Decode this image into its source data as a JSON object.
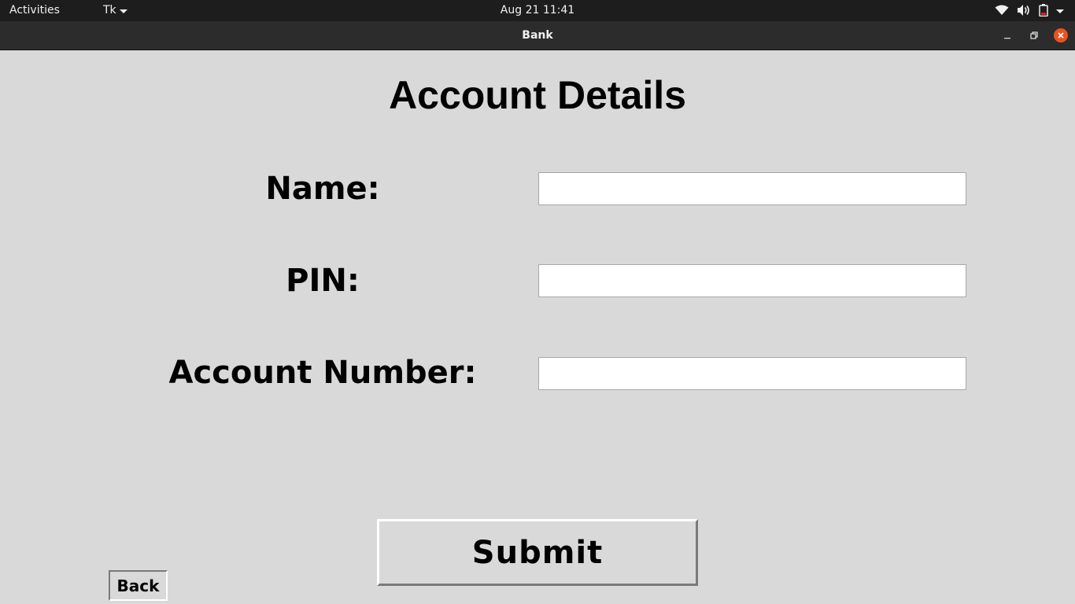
{
  "topbar": {
    "activities": "Activities",
    "app_menu": "Tk",
    "clock": "Aug 21  11:41",
    "icons": [
      "wifi-icon",
      "volume-icon",
      "battery-icon",
      "system-menu-caret-icon"
    ]
  },
  "window": {
    "title": "Bank",
    "controls": [
      "minimize",
      "maximize",
      "close"
    ],
    "close_color": "#e95420"
  },
  "form": {
    "heading": "Account Details",
    "fields": [
      {
        "label": "Name:",
        "value": ""
      },
      {
        "label": "PIN:",
        "value": ""
      },
      {
        "label": "Account Number:",
        "value": ""
      }
    ],
    "submit_label": "Submit",
    "back_label": "Back"
  },
  "colors": {
    "background": "#d9d9d9",
    "entry_background": "#ffffff",
    "topbar": "#1d1d1d",
    "titlebar": "#2c2c2c"
  }
}
